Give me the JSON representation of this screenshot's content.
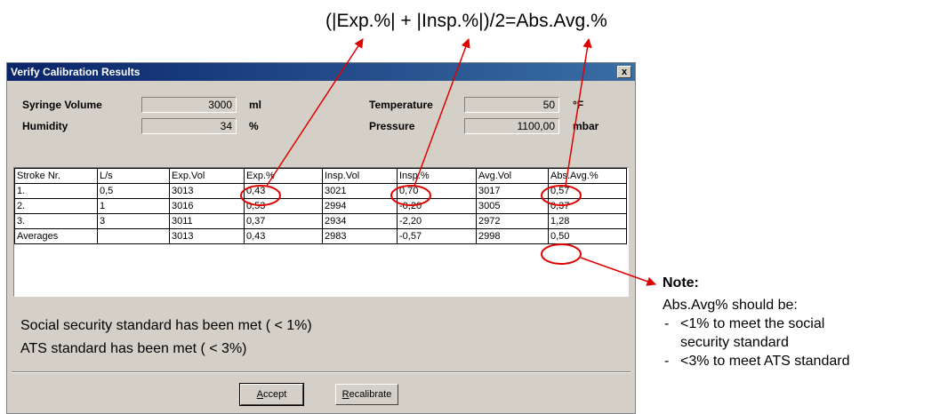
{
  "annotation": {
    "formula": "(|Exp.%| + |Insp.%|)/2=Abs.Avg.%",
    "note_title": "Note:",
    "note_intro": "Abs.Avg% should be:",
    "note_items": [
      "<1% to meet the social\nsecurity standard",
      "<3% to meet ATS standard"
    ],
    "colors": {
      "arrow": "#e00000"
    }
  },
  "window": {
    "title": "Verify Calibration Results",
    "close_label": "x"
  },
  "params": {
    "syringe_volume": {
      "label": "Syringe Volume",
      "value": "3000",
      "unit": "ml"
    },
    "humidity": {
      "label": "Humidity",
      "value": "34",
      "unit": "%"
    },
    "temperature": {
      "label": "Temperature",
      "value": "50",
      "unit": "°F"
    },
    "pressure": {
      "label": "Pressure",
      "value": "1100,00",
      "unit": "mbar"
    }
  },
  "table": {
    "headers": [
      "Stroke Nr.",
      "L/s",
      "Exp.Vol",
      "Exp.%",
      "Insp.Vol",
      "Insp.%",
      "Avg.Vol",
      "Abs.Avg.%"
    ],
    "rows": [
      [
        "1.",
        "0,5",
        "3013",
        "0,43",
        "3021",
        "0,70",
        "3017",
        "0,57"
      ],
      [
        "2.",
        "1",
        "3016",
        "0,53",
        "2994",
        "-0,20",
        "3005",
        "0,37"
      ],
      [
        "3.",
        "3",
        "3011",
        "0,37",
        "2934",
        "-2,20",
        "2972",
        "1,28"
      ],
      [
        "Averages",
        "",
        "3013",
        "0,43",
        "2983",
        "-0,57",
        "2998",
        "0,50"
      ]
    ]
  },
  "messages": {
    "social": "Social security standard has been met ( < 1%)",
    "ats": "ATS standard has been met ( < 3%)"
  },
  "buttons": {
    "accept_first": "A",
    "accept_rest": "ccept",
    "recalibrate_first": "R",
    "recalibrate_rest": "ecalibrate"
  }
}
